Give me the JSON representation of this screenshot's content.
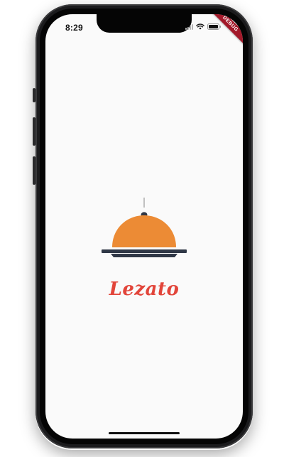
{
  "status_bar": {
    "time": "8:29",
    "icons": [
      "signal-icon",
      "wifi-icon",
      "battery-icon"
    ]
  },
  "debug_banner": {
    "label": "DEBUG",
    "color": "#a3192a"
  },
  "splash": {
    "logo_icon": "food-cloche-icon",
    "app_name": "Lezato"
  },
  "colors": {
    "brand_red": "#e2453a",
    "cloche_orange": "#ec8b35",
    "tray_dark": "#2f3746",
    "background": "#fafafa"
  }
}
